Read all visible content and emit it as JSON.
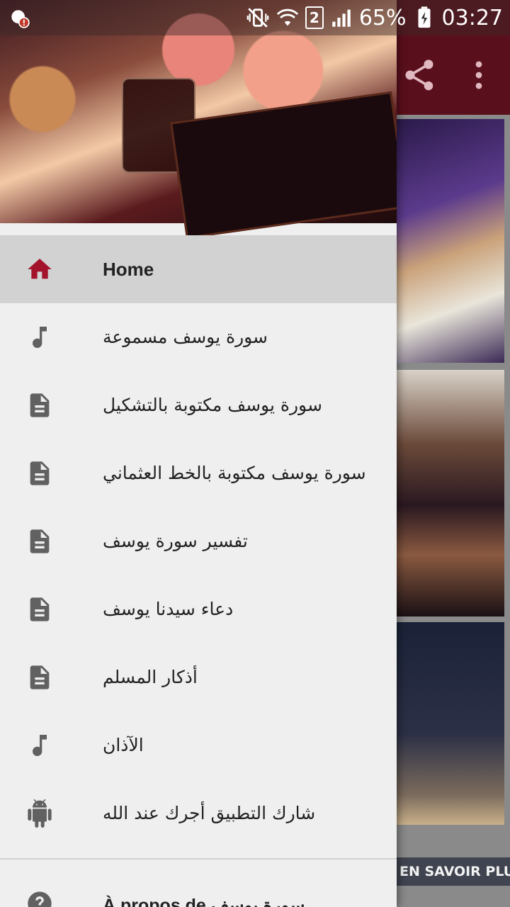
{
  "status_bar": {
    "battery": "65%",
    "time": "03:27",
    "sim_slot": "2"
  },
  "drawer": {
    "items": [
      {
        "label": "Home",
        "icon": "home-icon",
        "active": true
      },
      {
        "label": "سورة يوسف مسموعة",
        "icon": "music-note-icon"
      },
      {
        "label": "سورة يوسف مكتوبة بالتشكيل",
        "icon": "document-icon"
      },
      {
        "label": "سورة يوسف مكتوبة بالخط العثماني",
        "icon": "document-icon"
      },
      {
        "label": "تفسير سورة يوسف",
        "icon": "document-icon"
      },
      {
        "label": "دعاء سيدنا يوسف",
        "icon": "document-icon"
      },
      {
        "label": "أذكار المسلم",
        "icon": "document-icon"
      },
      {
        "label": "الآذان",
        "icon": "music-note-icon"
      },
      {
        "label": "شارك التطبيق أجرك عند الله",
        "icon": "android-icon"
      }
    ],
    "about_label": "À propos de سورة يوسف"
  },
  "background": {
    "ad_button_label": "EN SAVOIR PLUS"
  },
  "colors": {
    "accent": "#a3132b",
    "appbar": "#5a0f1c",
    "active_item_bg": "#d2d2d2"
  }
}
